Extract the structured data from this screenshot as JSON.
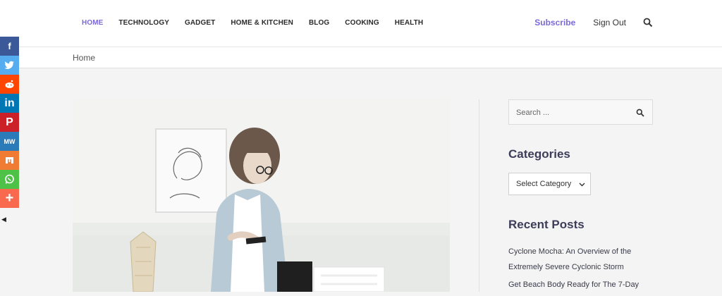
{
  "nav": {
    "items": [
      "HOME",
      "TECHNOLOGY",
      "GADGET",
      "HOME & KITCHEN",
      "BLOG",
      "COOKING",
      "HEALTH"
    ],
    "active_color": "#7a6ad8"
  },
  "header": {
    "subscribe": "Subscribe",
    "signout": "Sign Out"
  },
  "breadcrumb": {
    "label": "Home"
  },
  "social": [
    {
      "glyph": "f",
      "color": "#3b5998",
      "name": "facebook-icon"
    },
    {
      "glyph": "🐦",
      "color": "#55acee",
      "name": "twitter-icon"
    },
    {
      "glyph": "●",
      "color": "#ff4500",
      "name": "reddit-icon"
    },
    {
      "glyph": "in",
      "color": "#0077b5",
      "name": "linkedin-icon"
    },
    {
      "glyph": "P",
      "color": "#cb2027",
      "name": "pinterest-icon"
    },
    {
      "glyph": "MW",
      "color": "#2b7bb9",
      "name": "mewe-icon"
    },
    {
      "glyph": "m",
      "color": "#f07c34",
      "name": "mix-icon"
    },
    {
      "glyph": "✆",
      "color": "#4dc247",
      "name": "whatsapp-icon"
    },
    {
      "glyph": "+",
      "color": "#f8694d",
      "name": "more-share-icon"
    }
  ],
  "sidebar": {
    "search_placeholder": "Search ...",
    "categories_title": "Categories",
    "select_value": "Select Category",
    "recent_title": "Recent Posts",
    "recent_posts": [
      "Cyclone Mocha: An Overview of the Extremely Severe Cyclonic Storm",
      "Get Beach Body Ready for The 7-Day"
    ]
  }
}
